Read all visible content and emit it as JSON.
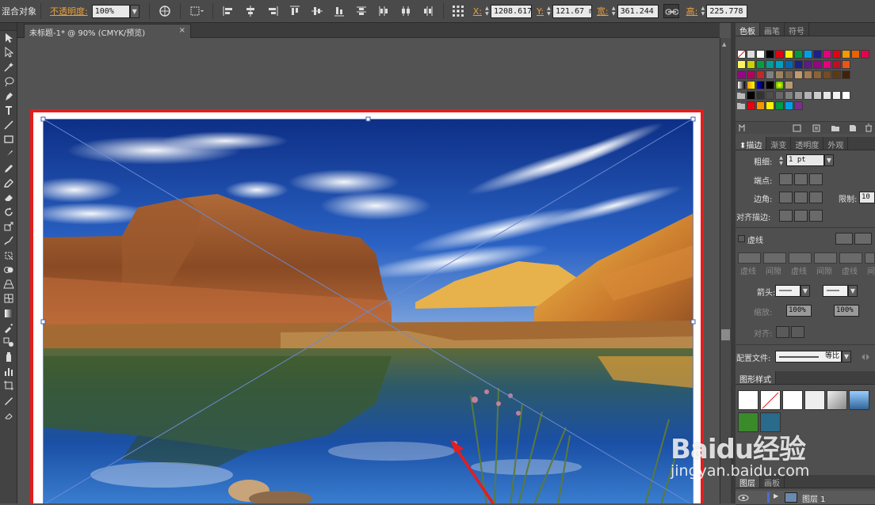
{
  "control_bar": {
    "object_type": "混合对象",
    "opacity_label": "不透明度:",
    "opacity_value": "100%",
    "x_label": "X:",
    "x_value": "1208.617",
    "y_label": "Y:",
    "y_value": "121.67 m",
    "w_label": "宽:",
    "w_value": "361.244 ",
    "h_label": "高:",
    "h_value": "225.778 "
  },
  "document": {
    "tab_title": "未标题-1* @ 90% (CMYK/预览)",
    "close_glyph": "×"
  },
  "swatches_panel": {
    "tabs": [
      "色板",
      "画笔",
      "符号"
    ],
    "colors": {
      "row1": [
        "#ffffff",
        "#000000",
        "#e40012",
        "#fff100",
        "#009944",
        "#00a0e9",
        "#1d2088",
        "#e4007f",
        "#e60012",
        "#f39800",
        "#eb6100",
        "#e5004f"
      ],
      "row2": [
        "#fff45c",
        "#c9d400",
        "#00a040",
        "#009e96",
        "#00a0c1",
        "#0068b7",
        "#1d2088",
        "#601986",
        "#920783",
        "#e4007f",
        "#c30d23",
        "#ea5514"
      ],
      "row3": [
        "#920783",
        "#b3005d",
        "#c1272d",
        "#808080",
        "#9d8461",
        "#7d6a4e",
        "#c49a6c",
        "#a67c52",
        "#8c6239",
        "#754c24",
        "#603913",
        "#42210b"
      ],
      "row5": [
        "#000000",
        "#333333",
        "#4d4d4d",
        "#666666",
        "#808080",
        "#999999",
        "#b3b3b3",
        "#cccccc",
        "#e6e6e6",
        "#f2f2f2",
        "#ffffff"
      ],
      "row6": [
        "#e60012",
        "#f39800",
        "#fff100",
        "#009944",
        "#00a0e9",
        "#7d2c8e"
      ]
    }
  },
  "stroke_panel": {
    "tabs": [
      "描边",
      "渐变",
      "透明度",
      "外观"
    ],
    "weight_label": "粗细:",
    "weight_value": "1 pt",
    "cap_label": "端点:",
    "corner_label": "边角:",
    "limit_label": "限制:",
    "limit_value": "10",
    "align_label": "对齐描边:",
    "dashed_label": "虚线",
    "dash_labels": [
      "虚线",
      "间隙",
      "虚线",
      "间隙",
      "虚线",
      "间"
    ],
    "arrow_label": "箭头:",
    "scale_label": "缩放:",
    "scale_value_1": "100%",
    "scale_value_2": "100%",
    "align_arrow_label": "对齐:",
    "profile_label": "配置文件:",
    "profile_value": "等比"
  },
  "graphic_styles_panel": {
    "title": "图形样式"
  },
  "layers_panel": {
    "tabs": [
      "图层",
      "画板"
    ],
    "layer_name": "图层 1"
  },
  "watermark": {
    "brand": "Baidu经验",
    "url": "jingyan.baidu.com"
  }
}
